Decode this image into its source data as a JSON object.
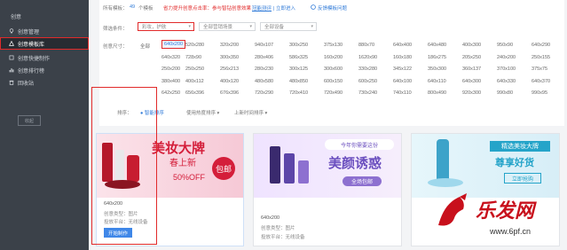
{
  "sidebar": {
    "logo": "创意",
    "items": [
      {
        "label": "创意管理",
        "icon": "bulb-icon"
      },
      {
        "label": "创意模板库",
        "icon": "template-icon"
      },
      {
        "label": "创意快捷制作",
        "icon": "lightning-icon"
      },
      {
        "label": "创意排行榜",
        "icon": "chart-icon"
      },
      {
        "label": "回收站",
        "icon": "trash-icon"
      }
    ],
    "collapse_label": "收起"
  },
  "header": {
    "label": "所有模板：",
    "count": "49",
    "count_suffix": "个模板",
    "promo": "省力提升创意点击率：参与智钻创意效果",
    "promo_link": "冠能测评",
    "enter": "| 立即进入",
    "feedback": "反馈模板问题"
  },
  "filter": {
    "label": "筛选条件：",
    "tags_value": "彩妆，护肤",
    "select2": "全部营销场景",
    "select3": "全部设备"
  },
  "size_filter": {
    "label": "创意尺寸：",
    "all": "全部",
    "rows": [
      [
        "640x200",
        "520x280",
        "320x200",
        "940x107",
        "300x250",
        "375x130",
        "880x70",
        "640x400",
        "640x480",
        "400x300",
        "950x90",
        "640x290"
      ],
      [
        "640x320",
        "728x90",
        "300x350",
        "280x406",
        "586x325",
        "160x200",
        "1620x90",
        "160x180",
        "186x275",
        "205x250",
        "240x200",
        "250x155"
      ],
      [
        "250x200",
        "250x250",
        "256x213",
        "280x230",
        "300x125",
        "300x600",
        "330x280",
        "345x122",
        "350x300",
        "360x137",
        "370x100",
        "375x75"
      ],
      [
        "380x400",
        "400x112",
        "400x120",
        "480x580",
        "480x850",
        "600x150",
        "600x250",
        "640x100",
        "640x110",
        "640x300",
        "640x330",
        "640x370"
      ],
      [
        "642x250",
        "656x396",
        "676x396",
        "720x290",
        "720x410",
        "720x490",
        "730x240",
        "740x110",
        "800x490",
        "920x300",
        "990x80",
        "990x95"
      ]
    ]
  },
  "sort": {
    "label": "排序：",
    "options": [
      "智能排序",
      "使用热度排序",
      "上新时间排序"
    ]
  },
  "cards": [
    {
      "size": "640x200",
      "type": "创意类型：图片",
      "device": "投放平台：无线设备",
      "button": "开始制作",
      "banner": {
        "line1": "美妆大牌",
        "line2": "春上新",
        "badge": "包邮",
        "discount": "50%OFF"
      }
    },
    {
      "size": "640x200",
      "type": "创意类型：图片",
      "device": "投放平台：无线设备",
      "banner": {
        "line1": "今年你需要这份",
        "line2": "美颜诱惑",
        "button": "全场包邮"
      }
    },
    {
      "banner": {
        "line1": "精选美妆大牌",
        "line2": "尊享好货",
        "cta": "立即抢购"
      }
    }
  ],
  "watermark": {
    "title": "乐发网",
    "url": "www.6pf.cn"
  },
  "colors": {
    "accent": "#2f7ad8",
    "highlight": "#e12a2a",
    "sidebar": "#3b4149"
  }
}
